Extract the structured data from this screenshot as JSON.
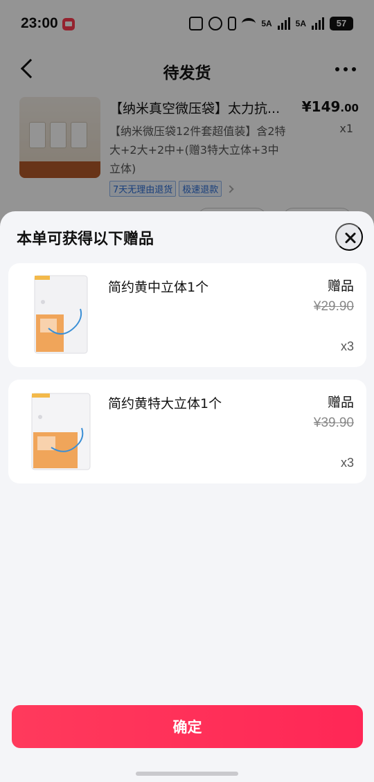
{
  "status_bar": {
    "time": "23:00",
    "signal_1": "5A",
    "signal_2": "5A",
    "battery": "57"
  },
  "nav": {
    "title": "待发货"
  },
  "order_item": {
    "title": "【纳米真空微压袋】太力抗...",
    "price_main": "¥149",
    "price_cents": ".00",
    "spec": "【纳米微压袋12件套超值装】含2特大+2大+2中+(赠3特大立体+3中立体)",
    "quantity": "x1",
    "tags": [
      "7天无理由退货",
      "极速退款"
    ]
  },
  "sheet": {
    "title": "本单可获得以下赠品",
    "gifts": [
      {
        "name": "简约黄中立体1个",
        "label": "赠品",
        "original_price": "¥29.90",
        "quantity": "x3"
      },
      {
        "name": "简约黄特大立体1个",
        "label": "赠品",
        "original_price": "¥39.90",
        "quantity": "x3"
      }
    ],
    "confirm_label": "确定"
  },
  "colors": {
    "accent": "#ff2d58",
    "sheet_bg": "#f4f5f8",
    "tag_blue": "#2b6cd4"
  }
}
